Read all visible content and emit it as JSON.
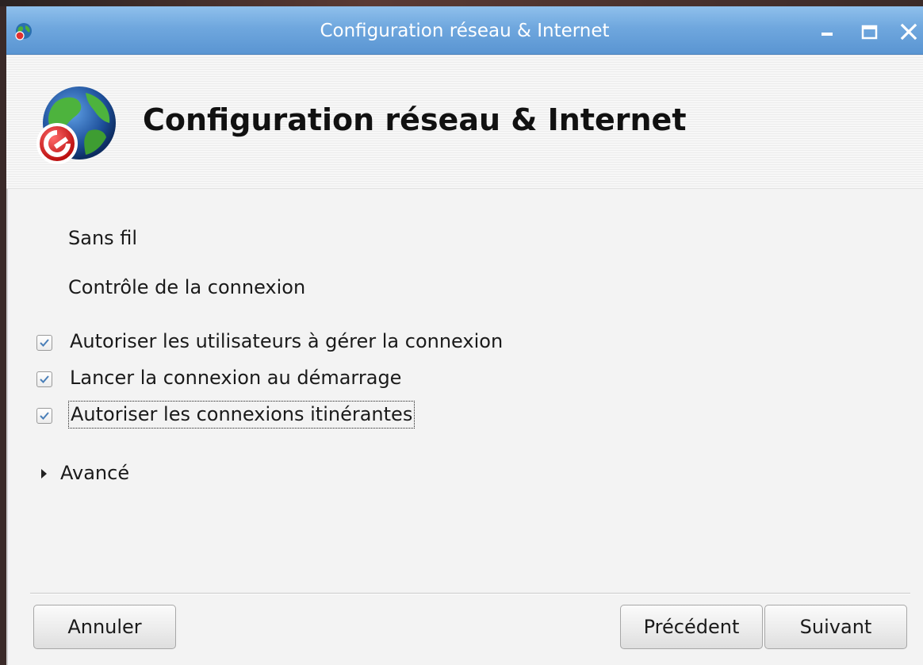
{
  "window": {
    "title": "Configuration réseau & Internet",
    "app_icon": "network-globe-icon",
    "controls": [
      "minimize-icon",
      "maximize-icon",
      "close-icon"
    ]
  },
  "header": {
    "heading": "Configuration réseau & Internet",
    "icon": "globe-with-wrench-icon"
  },
  "main": {
    "section_title": "Sans fil",
    "subsection_title": "Contrôle de la connexion",
    "checkboxes": [
      {
        "label": "Autoriser les utilisateurs à gérer la connexion",
        "checked": true
      },
      {
        "label": "Lancer la connexion au démarrage",
        "checked": true
      },
      {
        "label": "Autoriser les connexions itinérantes",
        "checked": true,
        "focused": true
      }
    ],
    "expander_label": "Avancé"
  },
  "buttons": {
    "cancel": "Annuler",
    "previous": "Précédent",
    "next": "Suivant"
  },
  "colors": {
    "titlebar": "#6fa7de",
    "checkmark": "#4a7fb8"
  }
}
